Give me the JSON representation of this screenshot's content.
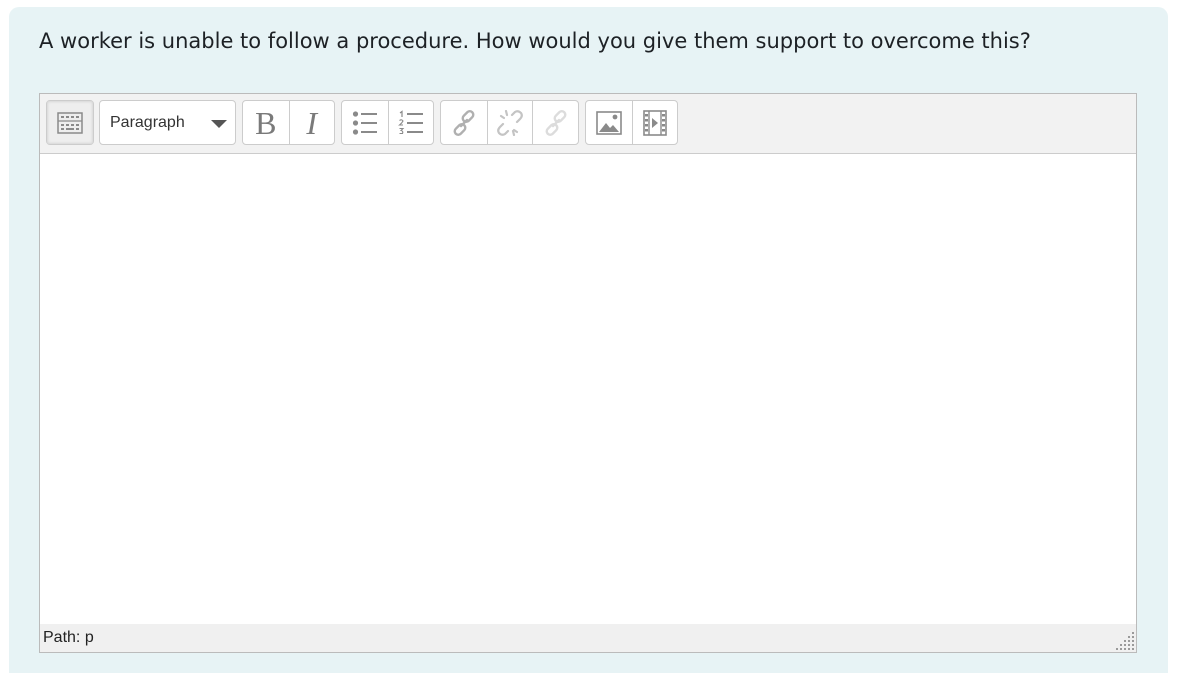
{
  "question": {
    "text": "A worker is unable to follow a procedure. How would you give them support to overcome this?"
  },
  "editor": {
    "toolbar": {
      "toggle_icon": "toolbar-toggle-icon",
      "format_select": {
        "selected": "Paragraph"
      },
      "bold_label": "B",
      "italic_label": "I",
      "icons": [
        "bold-icon",
        "italic-icon",
        "bulleted-list-icon",
        "numbered-list-icon",
        "link-icon",
        "unlink-icon",
        "anchor-icon",
        "image-icon",
        "media-icon"
      ]
    },
    "content": "",
    "statusbar": {
      "path_label": "Path:",
      "path_value": "p"
    }
  },
  "colors": {
    "card_background": "#e7f3f5",
    "toolbar_background": "#f2f2f2",
    "border": "#bbbbbb",
    "text": "#1d2125"
  }
}
